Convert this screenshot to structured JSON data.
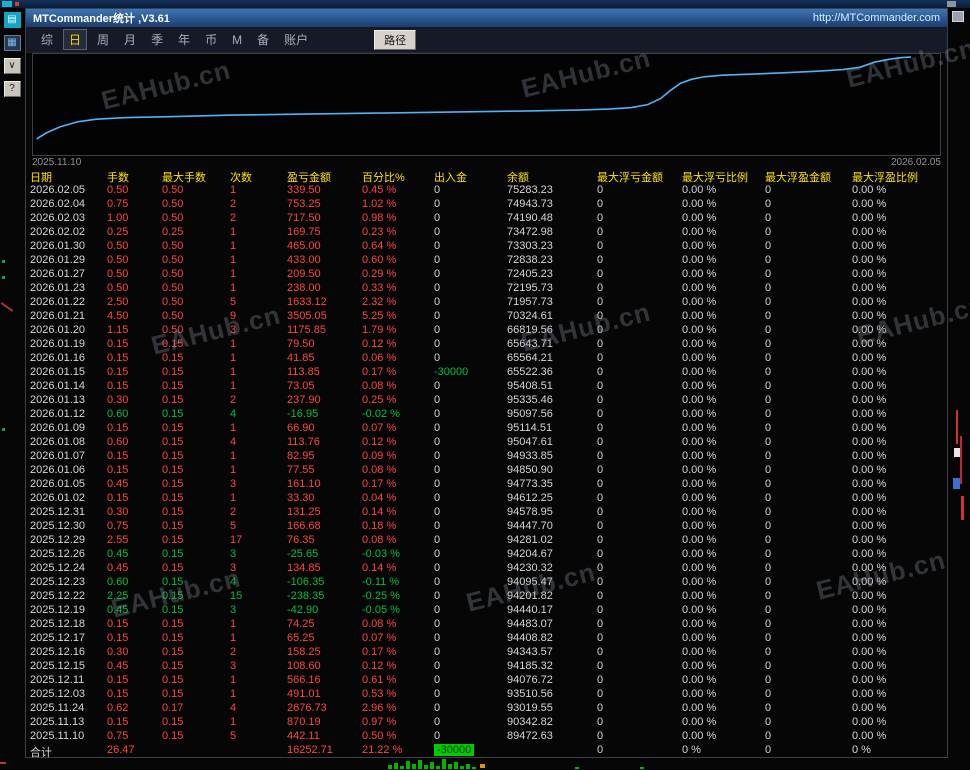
{
  "window": {
    "title": "MTCommander统计 ,V3.61",
    "url": "http://MTCommander.com"
  },
  "tabs": {
    "items": [
      "综",
      "日",
      "周",
      "月",
      "季",
      "年",
      "币",
      "M",
      "备",
      "账户"
    ],
    "selected": "日",
    "path_button": "路径"
  },
  "side_icons": [
    {
      "name": "chart-widget-icon",
      "glyph": "▤"
    },
    {
      "name": "grid-widget-icon",
      "glyph": "▦"
    },
    {
      "name": "collapse-button",
      "glyph": "∨"
    },
    {
      "name": "help-button",
      "glyph": "?"
    }
  ],
  "watermark": {
    "text": "EAHub.cn"
  },
  "chart": {
    "type": "line",
    "title": "equity-curve",
    "start_label": "2025.11.10",
    "end_label": "2026.02.05",
    "line_color": "#4fb3f6",
    "points": [
      [
        0.004,
        0.84
      ],
      [
        0.015,
        0.78
      ],
      [
        0.03,
        0.72
      ],
      [
        0.05,
        0.67
      ],
      [
        0.07,
        0.645
      ],
      [
        0.1,
        0.63
      ],
      [
        0.15,
        0.62
      ],
      [
        0.22,
        0.605
      ],
      [
        0.3,
        0.595
      ],
      [
        0.38,
        0.585
      ],
      [
        0.46,
        0.575
      ],
      [
        0.54,
        0.565
      ],
      [
        0.6,
        0.555
      ],
      [
        0.635,
        0.545
      ],
      [
        0.66,
        0.53
      ],
      [
        0.678,
        0.5
      ],
      [
        0.692,
        0.44
      ],
      [
        0.703,
        0.36
      ],
      [
        0.714,
        0.29
      ],
      [
        0.726,
        0.25
      ],
      [
        0.74,
        0.225
      ],
      [
        0.76,
        0.21
      ],
      [
        0.79,
        0.2
      ],
      [
        0.83,
        0.185
      ],
      [
        0.865,
        0.17
      ],
      [
        0.893,
        0.155
      ],
      [
        0.912,
        0.13
      ],
      [
        0.928,
        0.08
      ],
      [
        0.945,
        0.05
      ],
      [
        0.958,
        0.035
      ],
      [
        0.968,
        0.03
      ]
    ]
  },
  "table": {
    "headers": [
      "日期",
      "手数",
      "最大手数",
      "次数",
      "盈亏金额",
      "百分比%",
      "出入金",
      "余额",
      "最大浮亏金额",
      "最大浮亏比例",
      "最大浮盈金额",
      "最大浮盈比例"
    ],
    "rows": [
      [
        "2026.02.05",
        "0.50",
        "0.50",
        "1",
        "339.50",
        "0.45 %",
        "0",
        "75283.23",
        "0",
        "0.00 %",
        "0",
        "0.00 %",
        "up"
      ],
      [
        "2026.02.04",
        "0.75",
        "0.50",
        "2",
        "753.25",
        "1.02 %",
        "0",
        "74943.73",
        "0",
        "0.00 %",
        "0",
        "0.00 %",
        "up"
      ],
      [
        "2026.02.03",
        "1.00",
        "0.50",
        "2",
        "717.50",
        "0.98 %",
        "0",
        "74190.48",
        "0",
        "0.00 %",
        "0",
        "0.00 %",
        "up"
      ],
      [
        "2026.02.02",
        "0.25",
        "0.25",
        "1",
        "169.75",
        "0.23 %",
        "0",
        "73472.98",
        "0",
        "0.00 %",
        "0",
        "0.00 %",
        "up"
      ],
      [
        "2026.01.30",
        "0.50",
        "0.50",
        "1",
        "465.00",
        "0.64 %",
        "0",
        "73303.23",
        "0",
        "0.00 %",
        "0",
        "0.00 %",
        "up"
      ],
      [
        "2026.01.29",
        "0.50",
        "0.50",
        "1",
        "433.00",
        "0.60 %",
        "0",
        "72838.23",
        "0",
        "0.00 %",
        "0",
        "0.00 %",
        "up"
      ],
      [
        "2026.01.27",
        "0.50",
        "0.50",
        "1",
        "209.50",
        "0.29 %",
        "0",
        "72405.23",
        "0",
        "0.00 %",
        "0",
        "0.00 %",
        "up"
      ],
      [
        "2026.01.23",
        "0.50",
        "0.50",
        "1",
        "238.00",
        "0.33 %",
        "0",
        "72195.73",
        "0",
        "0.00 %",
        "0",
        "0.00 %",
        "up"
      ],
      [
        "2026.01.22",
        "2.50",
        "0.50",
        "5",
        "1633.12",
        "2.32 %",
        "0",
        "71957.73",
        "0",
        "0.00 %",
        "0",
        "0.00 %",
        "up"
      ],
      [
        "2026.01.21",
        "4.50",
        "0.50",
        "9",
        "3505.05",
        "5.25 %",
        "0",
        "70324.61",
        "0",
        "0.00 %",
        "0",
        "0.00 %",
        "up"
      ],
      [
        "2026.01.20",
        "1.15",
        "0.50",
        "3",
        "1175.85",
        "1.79 %",
        "0",
        "66819.56",
        "0",
        "0.00 %",
        "0",
        "0.00 %",
        "up"
      ],
      [
        "2026.01.19",
        "0.15",
        "0.15",
        "1",
        "79.50",
        "0.12 %",
        "0",
        "65643.71",
        "0",
        "0.00 %",
        "0",
        "0.00 %",
        "up"
      ],
      [
        "2026.01.16",
        "0.15",
        "0.15",
        "1",
        "41.85",
        "0.06 %",
        "0",
        "65564.21",
        "0",
        "0.00 %",
        "0",
        "0.00 %",
        "up"
      ],
      [
        "2026.01.15",
        "0.15",
        "0.15",
        "1",
        "113.85",
        "0.17 %",
        "-30000",
        "65522.36",
        "0",
        "0.00 %",
        "0",
        "0.00 %",
        "up"
      ],
      [
        "2026.01.14",
        "0.15",
        "0.15",
        "1",
        "73.05",
        "0.08 %",
        "0",
        "95408.51",
        "0",
        "0.00 %",
        "0",
        "0.00 %",
        "up"
      ],
      [
        "2026.01.13",
        "0.30",
        "0.15",
        "2",
        "237.90",
        "0.25 %",
        "0",
        "95335.46",
        "0",
        "0.00 %",
        "0",
        "0.00 %",
        "up"
      ],
      [
        "2026.01.12",
        "0.60",
        "0.15",
        "4",
        "-16.95",
        "-0.02 %",
        "0",
        "95097.56",
        "0",
        "0.00 %",
        "0",
        "0.00 %",
        "dn"
      ],
      [
        "2026.01.09",
        "0.15",
        "0.15",
        "1",
        "66.90",
        "0.07 %",
        "0",
        "95114.51",
        "0",
        "0.00 %",
        "0",
        "0.00 %",
        "up"
      ],
      [
        "2026.01.08",
        "0.60",
        "0.15",
        "4",
        "113.76",
        "0.12 %",
        "0",
        "95047.61",
        "0",
        "0.00 %",
        "0",
        "0.00 %",
        "up"
      ],
      [
        "2026.01.07",
        "0.15",
        "0.15",
        "1",
        "82.95",
        "0.09 %",
        "0",
        "94933.85",
        "0",
        "0.00 %",
        "0",
        "0.00 %",
        "up"
      ],
      [
        "2026.01.06",
        "0.15",
        "0.15",
        "1",
        "77.55",
        "0.08 %",
        "0",
        "94850.90",
        "0",
        "0.00 %",
        "0",
        "0.00 %",
        "up"
      ],
      [
        "2026.01.05",
        "0.45",
        "0.15",
        "3",
        "161.10",
        "0.17 %",
        "0",
        "94773.35",
        "0",
        "0.00 %",
        "0",
        "0.00 %",
        "up"
      ],
      [
        "2026.01.02",
        "0.15",
        "0.15",
        "1",
        "33.30",
        "0.04 %",
        "0",
        "94612.25",
        "0",
        "0.00 %",
        "0",
        "0.00 %",
        "up"
      ],
      [
        "2025.12.31",
        "0.30",
        "0.15",
        "2",
        "131.25",
        "0.14 %",
        "0",
        "94578.95",
        "0",
        "0.00 %",
        "0",
        "0.00 %",
        "up"
      ],
      [
        "2025.12.30",
        "0.75",
        "0.15",
        "5",
        "166.68",
        "0.18 %",
        "0",
        "94447.70",
        "0",
        "0.00 %",
        "0",
        "0.00 %",
        "up"
      ],
      [
        "2025.12.29",
        "2.55",
        "0.15",
        "17",
        "76.35",
        "0.08 %",
        "0",
        "94281.02",
        "0",
        "0.00 %",
        "0",
        "0.00 %",
        "up"
      ],
      [
        "2025.12.26",
        "0.45",
        "0.15",
        "3",
        "-25.65",
        "-0.03 %",
        "0",
        "94204.67",
        "0",
        "0.00 %",
        "0",
        "0.00 %",
        "dn"
      ],
      [
        "2025.12.24",
        "0.45",
        "0.15",
        "3",
        "134.85",
        "0.14 %",
        "0",
        "94230.32",
        "0",
        "0.00 %",
        "0",
        "0.00 %",
        "up"
      ],
      [
        "2025.12.23",
        "0.60",
        "0.15",
        "4",
        "-106.35",
        "-0.11 %",
        "0",
        "94095.47",
        "0",
        "0.00 %",
        "0",
        "0.00 %",
        "dn"
      ],
      [
        "2025.12.22",
        "2.25",
        "0.15",
        "15",
        "-238.35",
        "-0.25 %",
        "0",
        "94201.82",
        "0",
        "0.00 %",
        "0",
        "0.00 %",
        "dn"
      ],
      [
        "2025.12.19",
        "0.45",
        "0.15",
        "3",
        "-42.90",
        "-0.05 %",
        "0",
        "94440.17",
        "0",
        "0.00 %",
        "0",
        "0.00 %",
        "dn"
      ],
      [
        "2025.12.18",
        "0.15",
        "0.15",
        "1",
        "74.25",
        "0.08 %",
        "0",
        "94483.07",
        "0",
        "0.00 %",
        "0",
        "0.00 %",
        "up"
      ],
      [
        "2025.12.17",
        "0.15",
        "0.15",
        "1",
        "65.25",
        "0.07 %",
        "0",
        "94408.82",
        "0",
        "0.00 %",
        "0",
        "0.00 %",
        "up"
      ],
      [
        "2025.12.16",
        "0.30",
        "0.15",
        "2",
        "158.25",
        "0.17 %",
        "0",
        "94343.57",
        "0",
        "0.00 %",
        "0",
        "0.00 %",
        "up"
      ],
      [
        "2025.12.15",
        "0.45",
        "0.15",
        "3",
        "108.60",
        "0.12 %",
        "0",
        "94185.32",
        "0",
        "0.00 %",
        "0",
        "0.00 %",
        "up"
      ],
      [
        "2025.12.11",
        "0.15",
        "0.15",
        "1",
        "566.16",
        "0.61 %",
        "0",
        "94076.72",
        "0",
        "0.00 %",
        "0",
        "0.00 %",
        "up"
      ],
      [
        "2025.12.03",
        "0.15",
        "0.15",
        "1",
        "491.01",
        "0.53 %",
        "0",
        "93510.56",
        "0",
        "0.00 %",
        "0",
        "0.00 %",
        "up"
      ],
      [
        "2025.11.24",
        "0.62",
        "0.17",
        "4",
        "2676.73",
        "2.96 %",
        "0",
        "93019.55",
        "0",
        "0.00 %",
        "0",
        "0.00 %",
        "up"
      ],
      [
        "2025.11.13",
        "0.15",
        "0.15",
        "1",
        "870.19",
        "0.97 %",
        "0",
        "90342.82",
        "0",
        "0.00 %",
        "0",
        "0.00 %",
        "up"
      ],
      [
        "2025.11.10",
        "0.75",
        "0.15",
        "5",
        "442.11",
        "0.50 %",
        "0",
        "89472.63",
        "0",
        "0.00 %",
        "0",
        "0.00 %",
        "up"
      ]
    ],
    "total": [
      "合计",
      "26.47",
      "",
      "",
      "16252.71",
      "21.22 %",
      "-30000",
      "",
      "0",
      "0 %",
      "0",
      "0 %"
    ]
  },
  "colors": {
    "profit": "#ff4545",
    "loss": "#00c040",
    "header": "#ffe400",
    "equity_line": "#4fb3f6",
    "highlight_bg": "#00cc00",
    "titlebar_top": "#3e75b6",
    "titlebar_bottom": "#1a3c6d"
  }
}
